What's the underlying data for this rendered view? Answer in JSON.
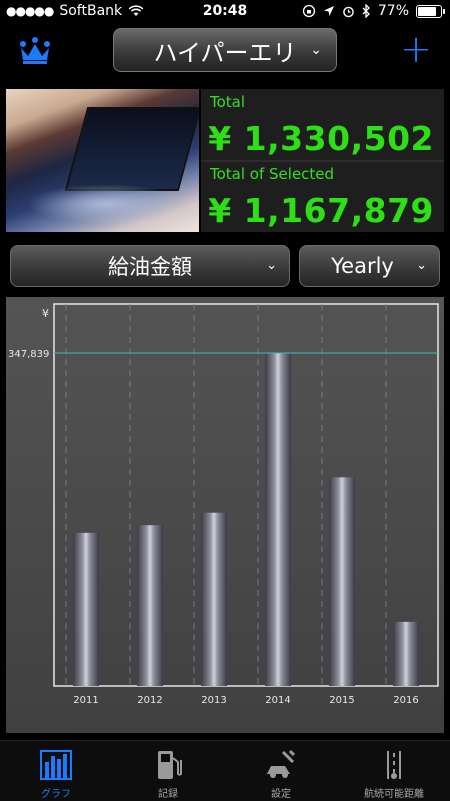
{
  "status_bar": {
    "carrier": "SoftBank",
    "time": "20:48",
    "battery": "77%",
    "battery_level": 0.77
  },
  "nav": {
    "vehicle": "ハイパーエリ"
  },
  "totals": {
    "total_label": "Total",
    "total_value": "¥ 1,330,502",
    "selected_label": "Total of Selected",
    "selected_value": "¥ 1,167,879"
  },
  "filters": {
    "metric": "給油金額",
    "period": "Yearly"
  },
  "chart_data": {
    "type": "bar",
    "categories": [
      "2011",
      "2012",
      "2013",
      "2014",
      "2015",
      "2016"
    ],
    "values": [
      160000,
      168000,
      181000,
      347839,
      218000,
      67000
    ],
    "ylabel": "¥",
    "ylim": [
      0,
      347839
    ],
    "max_line_label": "347,839",
    "grid": true
  },
  "tabbar": {
    "items": [
      {
        "label": "グラフ",
        "icon": "graph-icon",
        "active": true
      },
      {
        "label": "記録",
        "icon": "fuel-pump-icon",
        "active": false
      },
      {
        "label": "設定",
        "icon": "car-wrench-icon",
        "active": false
      },
      {
        "label": "航続可能距離",
        "icon": "range-icon",
        "active": false
      }
    ]
  },
  "colors": {
    "accent": "#1a7bff",
    "total_green": "#2de016",
    "ref_line": "#45b8c0"
  }
}
